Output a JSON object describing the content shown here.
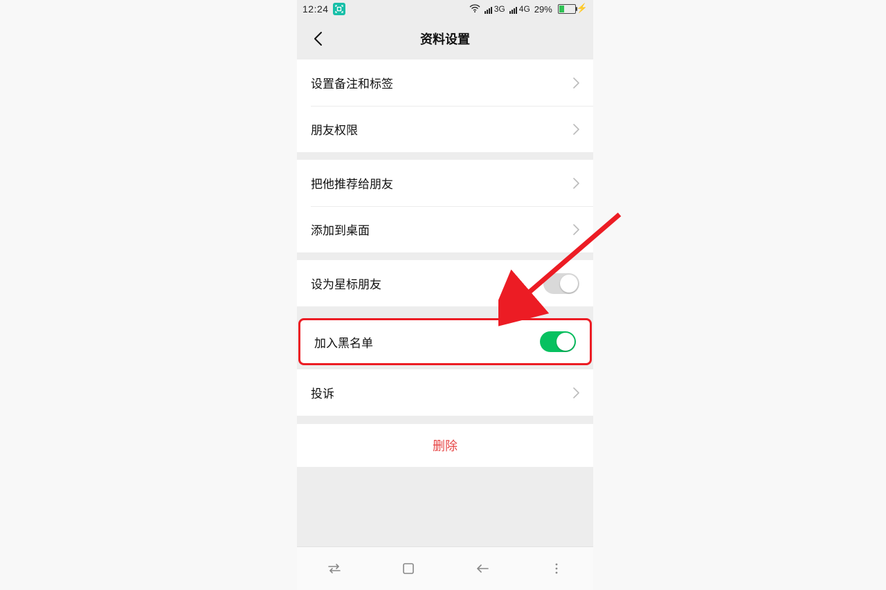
{
  "status": {
    "time": "12:24",
    "net1_label": "3G",
    "net2_label": "4G",
    "battery_pct": "29%"
  },
  "header": {
    "title": "资料设置"
  },
  "rows": {
    "remark_tag": "设置备注和标签",
    "friend_perm": "朋友权限",
    "recommend": "把他推荐给朋友",
    "add_desktop": "添加到桌面",
    "star_friend": "设为星标朋友",
    "blacklist": "加入黑名单",
    "complaint": "投诉"
  },
  "toggles": {
    "star_friend_on": false,
    "blacklist_on": true
  },
  "delete_label": "删除",
  "colors": {
    "accent_green": "#07c160",
    "danger_red": "#e64545",
    "highlight_border": "#ec1c24"
  }
}
